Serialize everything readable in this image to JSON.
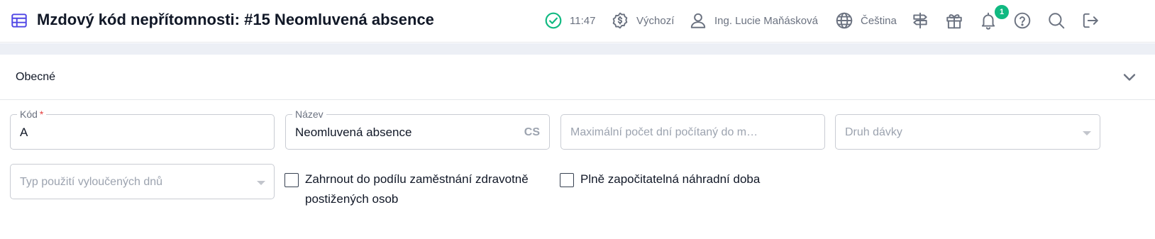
{
  "header": {
    "title": "Mzdový kód nepřítomnosti: #15 Neomluvená absence",
    "time": "11:47",
    "currency_label": "Výchozí",
    "user_name": "Ing. Lucie Maňásková",
    "language": "Čeština",
    "gift_badge_count": "1",
    "icons": [
      "table-icon",
      "check-circle-icon",
      "dollar-badge-icon",
      "user-icon",
      "globe-icon",
      "signpost-icon",
      "gift-icon",
      "bell-icon",
      "help-icon",
      "search-icon",
      "logout-icon"
    ],
    "accent_color": "#4f46e5",
    "status_color": "#10b981"
  },
  "section": {
    "title": "Obecné"
  },
  "form": {
    "kod": {
      "label": "Kód",
      "required_mark": "*",
      "value": "A"
    },
    "nazev": {
      "label": "Název",
      "value": "Neomluvená absence",
      "lang_suffix": "CS"
    },
    "max_dni": {
      "placeholder": "Maximální počet dní počítaný do m…"
    },
    "druh_davky": {
      "placeholder": "Druh dávky"
    },
    "typ_pouziti": {
      "placeholder": "Typ použití vyloučených dnů"
    },
    "zahrnout": {
      "label_line1": "Zahrnout do podílu zaměstnání zdravotně",
      "label_line2": "postižených osob",
      "checked": false
    },
    "plne": {
      "label": "Plně započitatelná náhradní doba",
      "checked": false
    }
  }
}
